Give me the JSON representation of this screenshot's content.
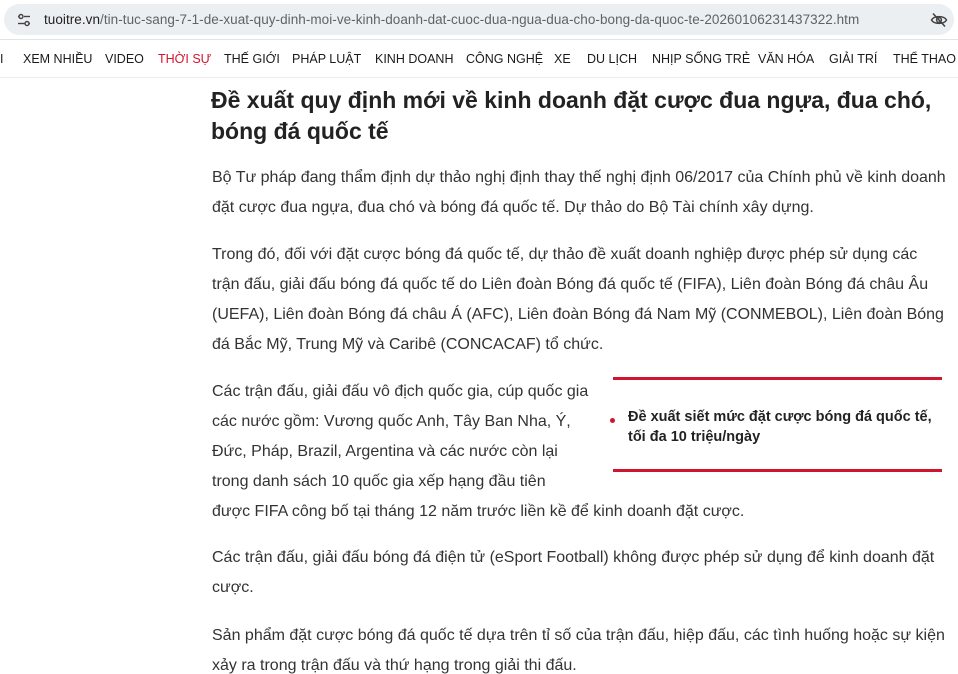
{
  "browser": {
    "url_host": "tuoitre.vn",
    "url_path": "/tin-tuc-sang-7-1-de-xuat-quy-dinh-moi-ve-kinh-doanh-dat-cuoc-dua-ngua-dua-cho-bong-da-quoc-te-20260106231437322.htm",
    "site_icon": "tune-icon",
    "tracking_icon": "eye-off-icon"
  },
  "nav": {
    "items": [
      {
        "label": "I",
        "active": false
      },
      {
        "label": "XEM NHIỀU",
        "active": false
      },
      {
        "label": "VIDEO",
        "active": false
      },
      {
        "label": "THỜI SỰ",
        "active": true
      },
      {
        "label": "THẾ GIỚI",
        "active": false
      },
      {
        "label": "PHÁP LUẬT",
        "active": false
      },
      {
        "label": "KINH DOANH",
        "active": false
      },
      {
        "label": "CÔNG NGHỆ",
        "active": false
      },
      {
        "label": "XE",
        "active": false
      },
      {
        "label": "DU LỊCH",
        "active": false
      },
      {
        "label": "NHỊP SỐNG TRẺ",
        "active": false
      },
      {
        "label": "VĂN HÓA",
        "active": false
      },
      {
        "label": "GIẢI TRÍ",
        "active": false
      },
      {
        "label": "THỂ THAO",
        "active": false
      }
    ],
    "active_color": "#d1152e"
  },
  "article": {
    "title": "Đề xuất quy định mới về kinh doanh đặt cược đua ngựa, đua chó, bóng đá quốc tế",
    "paragraphs": [
      "Bộ Tư pháp đang thẩm định dự thảo nghị định thay thế nghị định 06/2017 của Chính phủ về kinh doanh đặt cược đua ngựa, đua chó và bóng đá quốc tế. Dự thảo do Bộ Tài chính xây dựng.",
      "Trong đó, đối với đặt cược bóng đá quốc tế, dự thảo đề xuất doanh nghiệp được phép sử dụng các trận đấu, giải đấu bóng đá quốc tế do Liên đoàn Bóng đá quốc tế (FIFA), Liên đoàn Bóng đá châu Âu (UEFA), Liên đoàn Bóng đá châu Á (AFC), Liên đoàn Bóng đá Nam Mỹ (CONMEBOL), Liên đoàn Bóng đá Bắc Mỹ, Trung Mỹ và Caribê (CONCACAF) tổ chức.",
      "Các trận đấu, giải đấu vô địch quốc gia, cúp quốc gia các nước gồm: Vương quốc Anh, Tây Ban Nha, Ý, Đức, Pháp, Brazil, Argentina và các nước còn lại trong danh sách 10 quốc gia xếp hạng đầu tiên",
      "được FIFA công bố tại tháng 12 năm trước liền kề để kinh doanh đặt cược.",
      "Các trận đấu, giải đấu bóng đá điện tử (eSport Football) không được phép sử dụng để kinh doanh đặt cược.",
      "Sản phẩm đặt cược bóng đá quốc tế dựa trên tỉ số của trận đấu, hiệp đấu, các tình huống hoặc sự kiện xảy ra trong trận đấu và thứ hạng trong giải thi đấu."
    ],
    "related": {
      "text": "Đề xuất siết mức đặt cược bóng đá quốc tế, tối đa 10 triệu/ngày",
      "accent_color": "#d1152e"
    }
  }
}
